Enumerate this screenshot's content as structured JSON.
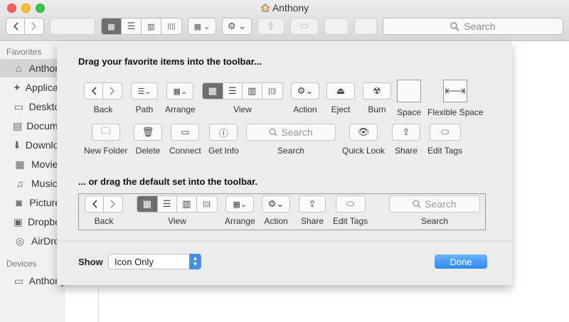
{
  "window": {
    "title": "Anthony"
  },
  "toolbar": {
    "search_placeholder": "Search"
  },
  "sidebar": {
    "favorites_header": "Favorites",
    "devices_header": "Devices",
    "items": [
      {
        "label": "Anthony",
        "icon": "home-icon"
      },
      {
        "label": "Applications",
        "icon": "applications-icon"
      },
      {
        "label": "Desktop",
        "icon": "desktop-icon"
      },
      {
        "label": "Documents",
        "icon": "document-icon"
      },
      {
        "label": "Downloads",
        "icon": "download-icon"
      },
      {
        "label": "Movies",
        "icon": "film-icon"
      },
      {
        "label": "Music",
        "icon": "music-icon"
      },
      {
        "label": "Pictures",
        "icon": "camera-icon"
      },
      {
        "label": "Dropbox",
        "icon": "dropbox-icon"
      },
      {
        "label": "AirDrop",
        "icon": "airdrop-icon"
      }
    ],
    "devices": [
      {
        "label": "Anthony",
        "icon": "laptop-icon"
      }
    ]
  },
  "customize": {
    "heading1": "Drag your favorite items into the toolbar...",
    "heading2": "... or drag the default set into the toolbar.",
    "items": {
      "back": "Back",
      "path": "Path",
      "arrange": "Arrange",
      "view": "View",
      "action": "Action",
      "eject": "Eject",
      "burn": "Burn",
      "space": "Space",
      "flexible_space": "Flexible Space",
      "new_folder": "New Folder",
      "delete": "Delete",
      "connect": "Connect",
      "get_info": "Get Info",
      "search": "Search",
      "quick_look": "Quick Look",
      "share": "Share",
      "edit_tags": "Edit Tags"
    },
    "search_placeholder": "Search",
    "default_set": {
      "back": "Back",
      "view": "View",
      "arrange": "Arrange",
      "action": "Action",
      "share": "Share",
      "edit_tags": "Edit Tags",
      "search": "Search",
      "search_placeholder": "Search"
    },
    "show_label": "Show",
    "show_value": "Icon Only",
    "done_label": "Done"
  },
  "colors": {
    "accent": "#2a8cf7",
    "selected_segment": "#6e6e6e",
    "close": "#fc5f57",
    "minimize": "#fdbc2e",
    "zoom": "#33c748"
  }
}
